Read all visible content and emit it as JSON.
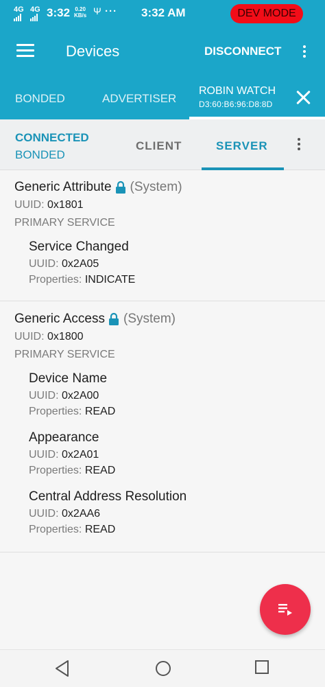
{
  "status_bar": {
    "signal_1": "4G",
    "signal_2": "4G",
    "time_left": "3:32",
    "speed_value": "0.20",
    "speed_unit": "KB/s",
    "more_dots": "···",
    "time_center": "3:32 AM",
    "dev_mode_badge": "DEV MODE"
  },
  "app_bar": {
    "title": "Devices",
    "disconnect_label": "DISCONNECT"
  },
  "device_tabs": [
    {
      "label": "BONDED"
    },
    {
      "label": "ADVERTISER"
    },
    {
      "label": "ROBIN WATCH",
      "address": "D3:60:B6:96:D8:8D",
      "selected": true
    }
  ],
  "connection": {
    "state": "CONNECTED",
    "bond_state": "BONDED",
    "tabs": [
      {
        "label": "CLIENT"
      },
      {
        "label": "SERVER",
        "selected": true
      }
    ]
  },
  "labels": {
    "uuid": "UUID:",
    "properties": "Properties:"
  },
  "services": [
    {
      "name": "Generic Attribute",
      "tag": "(System)",
      "uuid": "0x1801",
      "type": "PRIMARY SERVICE",
      "characteristics": [
        {
          "name": "Service Changed",
          "uuid": "0x2A05",
          "properties": "INDICATE"
        }
      ]
    },
    {
      "name": "Generic Access",
      "tag": "(System)",
      "uuid": "0x1800",
      "type": "PRIMARY SERVICE",
      "characteristics": [
        {
          "name": "Device Name",
          "uuid": "0x2A00",
          "properties": "READ"
        },
        {
          "name": "Appearance",
          "uuid": "0x2A01",
          "properties": "READ"
        },
        {
          "name": "Central Address Resolution",
          "uuid": "0x2AA6",
          "properties": "READ"
        }
      ]
    }
  ],
  "colors": {
    "primary": "#1ba6c9",
    "accent_text": "#1a93b7",
    "fab": "#ee2f4b",
    "dev_mode": "#f20d18"
  }
}
